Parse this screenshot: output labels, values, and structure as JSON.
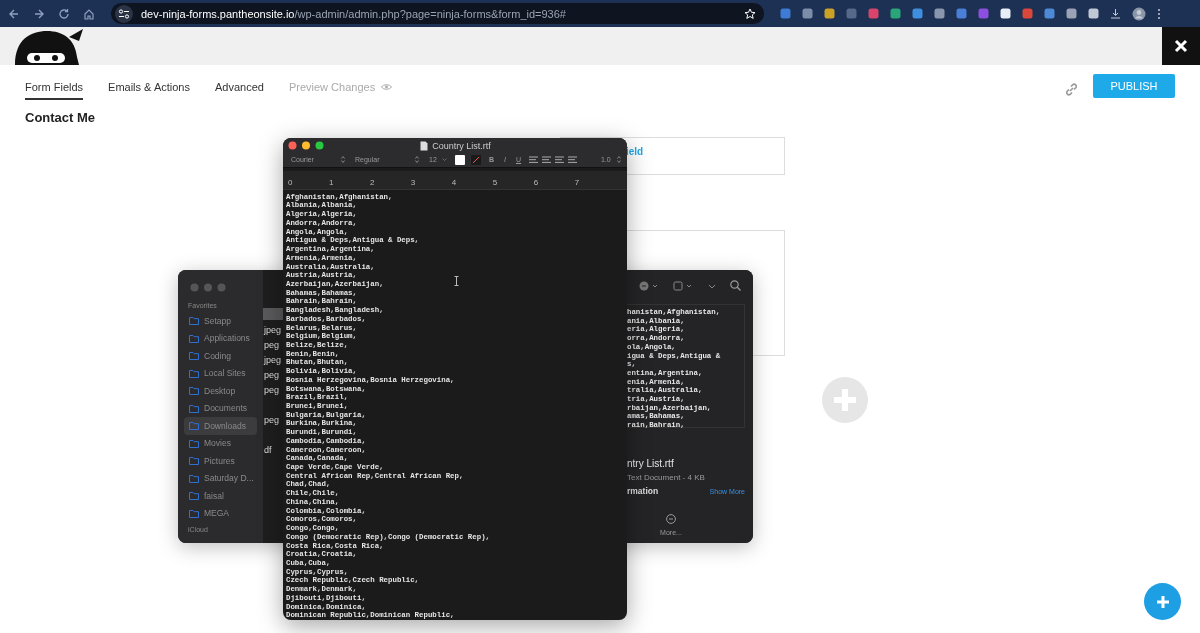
{
  "browser": {
    "url_host": "dev-ninja-forms.pantheonsite.io",
    "url_path": "/wp-admin/admin.php?page=ninja-forms&form_id=936#"
  },
  "builder": {
    "tabs": [
      {
        "label": "Form Fields",
        "selected": true,
        "disabled": false
      },
      {
        "label": "Emails & Actions",
        "selected": false,
        "disabled": false
      },
      {
        "label": "Advanced",
        "selected": false,
        "disabled": false
      },
      {
        "label": "Preview Changes",
        "selected": false,
        "disabled": true
      }
    ],
    "publish": "PUBLISH",
    "form_title": "Contact Me",
    "field_link": "ield"
  },
  "finder": {
    "section": "Favorites",
    "items": [
      {
        "label": "Setapp",
        "selected": false
      },
      {
        "label": "Applications",
        "selected": false
      },
      {
        "label": "Coding",
        "selected": false
      },
      {
        "label": "Local Sites",
        "selected": false
      },
      {
        "label": "Desktop",
        "selected": false
      },
      {
        "label": "Documents",
        "selected": false
      },
      {
        "label": "Downloads",
        "selected": true
      },
      {
        "label": "Movies",
        "selected": false
      },
      {
        "label": "Pictures",
        "selected": false
      },
      {
        "label": "Saturday D...",
        "selected": false
      },
      {
        "label": "faisal",
        "selected": false
      },
      {
        "label": "MEGA",
        "selected": false
      }
    ],
    "section_2": "iCloud",
    "files": [
      [
        "jpeg",
        "peg",
        "jpeg",
        "peg",
        "peg"
      ],
      [
        "peg"
      ],
      [
        "df"
      ]
    ],
    "preview_lines": [
      "hanistan,Afghanistan,",
      "ania,Albania,",
      "eria,Algeria,",
      "orra,Andorra,",
      "ola,Angola,",
      "igua & Deps,Antigua &",
      "s,",
      "entina,Argentina,",
      "enia,Armenia,",
      "tralia,Australia,",
      "tria,Austria,",
      "rbaijan,Azerbaijan,",
      "amas,Bahamas,",
      "rain,Bahrain,"
    ],
    "file_name": "ntry List.rtf",
    "file_kind": "Text Document - 4 KB",
    "info_heading": "rmation",
    "show_more": "Show More",
    "more": "More..."
  },
  "textedit": {
    "title": "Country List.rtf",
    "font": "Courier",
    "style": "Regular",
    "size": "12",
    "spacing": "1.0",
    "bold": "B",
    "italic": "I",
    "underline": "U",
    "ruler": [
      "0",
      "1",
      "2",
      "3",
      "4",
      "5",
      "6",
      "7"
    ],
    "lines": [
      "Afghanistan,Afghanistan,",
      "Albania,Albania,",
      "Algeria,Algeria,",
      "Andorra,Andorra,",
      "Angola,Angola,",
      "Antigua & Deps,Antigua & Deps,",
      "Argentina,Argentina,",
      "Armenia,Armenia,",
      "Australia,Australia,",
      "Austria,Austria,",
      "Azerbaijan,Azerbaijan,",
      "Bahamas,Bahamas,",
      "Bahrain,Bahrain,",
      "Bangladesh,Bangladesh,",
      "Barbados,Barbados,",
      "Belarus,Belarus,",
      "Belgium,Belgium,",
      "Belize,Belize,",
      "Benin,Benin,",
      "Bhutan,Bhutan,",
      "Bolivia,Bolivia,",
      "Bosnia Herzegovina,Bosnia Herzegovina,",
      "Botswana,Botswana,",
      "Brazil,Brazil,",
      "Brunei,Brunei,",
      "Bulgaria,Bulgaria,",
      "Burkina,Burkina,",
      "Burundi,Burundi,",
      "Cambodia,Cambodia,",
      "Cameroon,Cameroon,",
      "Canada,Canada,",
      "Cape Verde,Cape Verde,",
      "Central African Rep,Central African Rep,",
      "Chad,Chad,",
      "Chile,Chile,",
      "China,China,",
      "Colombia,Colombia,",
      "Comoros,Comoros,",
      "Congo,Congo,",
      "Congo (Democratic Rep),Congo (Democratic Rep),",
      "Costa Rica,Costa Rica,",
      "Croatia,Croatia,",
      "Cuba,Cuba,",
      "Cyprus,Cyprus,",
      "Czech Republic,Czech Republic,",
      "Denmark,Denmark,",
      "Djibouti,Djibouti,",
      "Dominica,Dominica,",
      "Dominican Republic,Dominican Republic,"
    ]
  }
}
